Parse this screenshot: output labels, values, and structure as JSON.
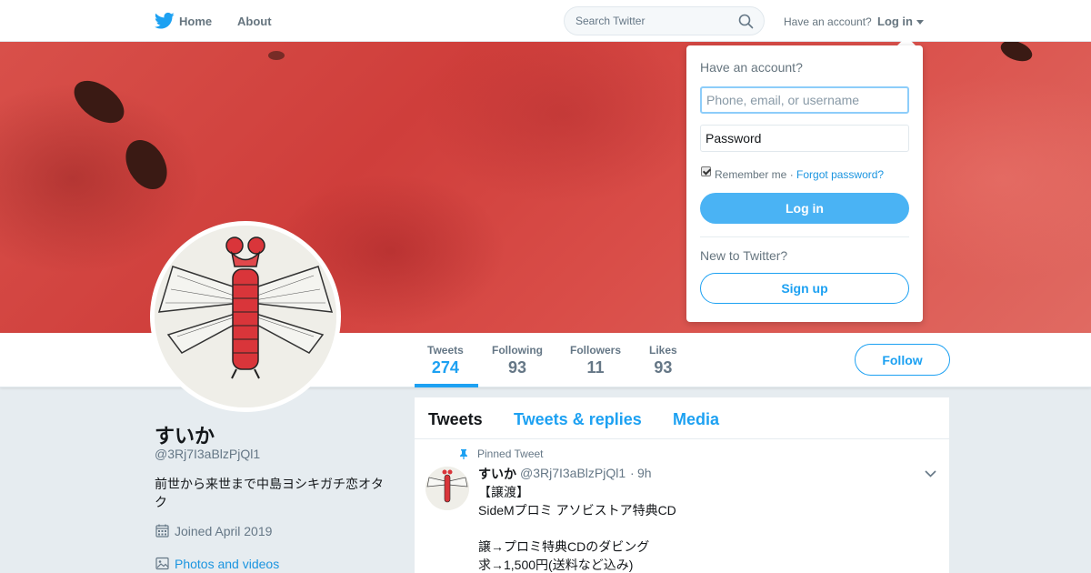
{
  "topbar": {
    "home_label": "Home",
    "about_label": "About",
    "search_placeholder": "Search Twitter",
    "have_account": "Have an account?",
    "login_label": "Log in",
    "icons": [
      "twitter-bird-icon",
      "search-icon",
      "caret-down-icon"
    ]
  },
  "profile": {
    "name": "すいか",
    "handle": "@3Rj7I3aBlzPjQl1",
    "bio": "前世から来世まで中島ヨシキガチ恋オタク",
    "joined": "Joined April 2019",
    "photos_link": "Photos and videos"
  },
  "stats": [
    {
      "label": "Tweets",
      "value": "274",
      "active": true
    },
    {
      "label": "Following",
      "value": "93"
    },
    {
      "label": "Followers",
      "value": "11"
    },
    {
      "label": "Likes",
      "value": "93"
    }
  ],
  "follow_label": "Follow",
  "timeline": {
    "tabs": [
      "Tweets",
      "Tweets & replies",
      "Media"
    ],
    "pinned_label": "Pinned Tweet",
    "tweet": {
      "name": "すいか",
      "handle": "@3Rj7I3aBlzPjQl1",
      "separator": "·",
      "time": "9h",
      "lines": [
        "【譲渡】",
        "SideMプロミ アソビストア特典CD",
        "",
        "譲→プロミ特典CDのダビング",
        "求→1,500円(送料など込み)"
      ]
    }
  },
  "login_dropdown": {
    "title": "Have an account?",
    "username_placeholder": "Phone, email, or username",
    "password_placeholder": "Password",
    "remember_label": "Remember me",
    "separator": "·",
    "forgot_label": "Forgot password?",
    "login_button": "Log in",
    "new_label": "New to Twitter?",
    "signup_button": "Sign up"
  },
  "colors": {
    "accent": "#1da1f2",
    "login_button": "#4ab3f4",
    "banner": "#d8504a"
  }
}
